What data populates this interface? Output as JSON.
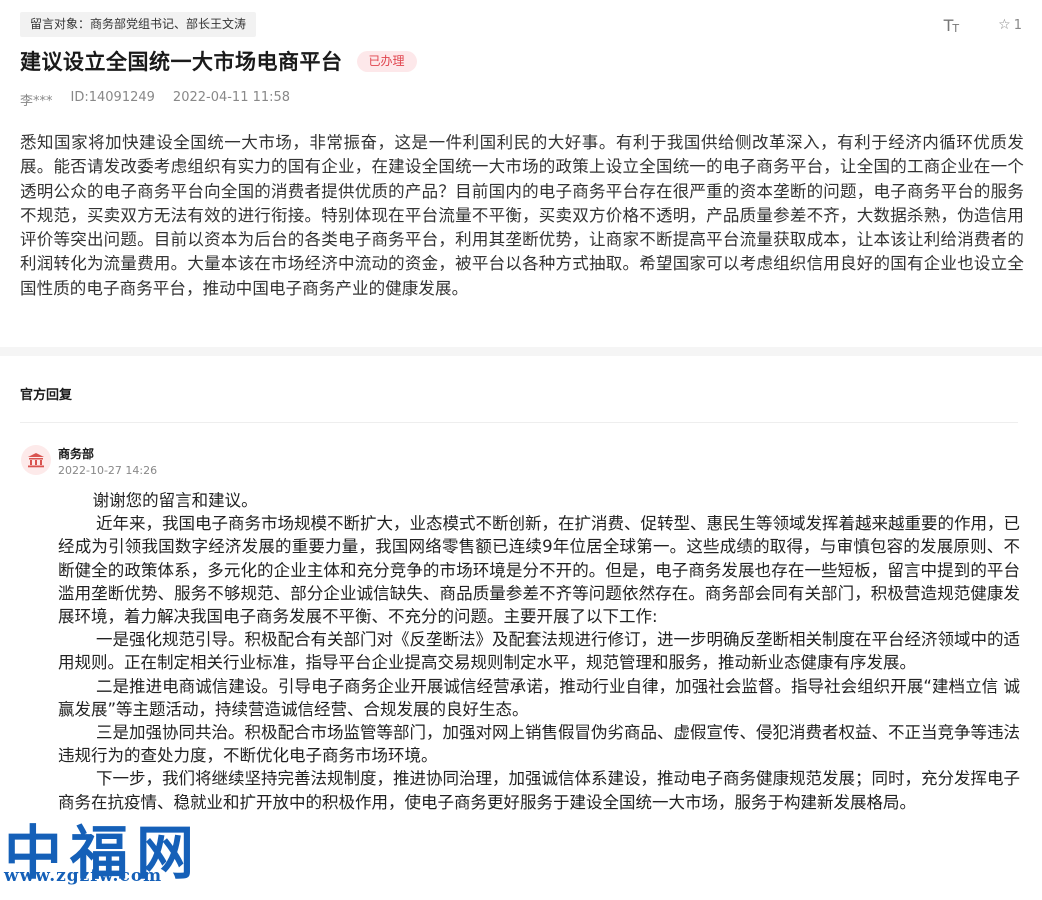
{
  "header": {
    "recipient": "留言对象：商务部党组书记、部长王文涛",
    "font_size_label": "TT",
    "star_icon": "star-outline-icon",
    "star_count": "1"
  },
  "post": {
    "title": "建议设立全国统一大市场电商平台",
    "status": "已办理",
    "author": "李***",
    "id": "ID:14091249",
    "datetime": "2022-04-11 11:58",
    "body": "悉知国家将加快建设全国统一大市场，非常振奋，这是一件利国利民的大好事。有利于我国供给侧改革深入，有利于经济内循环优质发展。能否请发改委考虑组织有实力的国有企业，在建设全国统一大市场的政策上设立全国统一的电子商务平台，让全国的工商企业在一个透明公众的电子商务平台向全国的消费者提供优质的产品？目前国内的电子商务平台存在很严重的资本垄断的问题，电子商务平台的服务不规范，买卖双方无法有效的进行衔接。特别体现在平台流量不平衡，买卖双方价格不透明，产品质量参差不齐，大数据杀熟，伪造信用评价等突出问题。目前以资本为后台的各类电子商务平台，利用其垄断优势，让商家不断提高平台流量获取成本，让本该让利给消费者的利润转化为流量费用。大量本该在市场经济中流动的资金，被平台以各种方式抽取。希望国家可以考虑组织信用良好的国有企业也设立全国性质的电子商务平台，推动中国电子商务产业的健康发展。"
  },
  "reply": {
    "heading": "官方回复",
    "department": "商务部",
    "department_icon": "government-building-icon",
    "datetime": "2022-10-27 14:26",
    "paragraphs": [
      "谢谢您的留言和建议。",
      "近年来，我国电子商务市场规模不断扩大，业态模式不断创新，在扩消费、促转型、惠民生等领域发挥着越来越重要的作用，已经成为引领我国数字经济发展的重要力量，我国网络零售额已连续9年位居全球第一。这些成绩的取得，与审慎包容的发展原则、不断健全的政策体系，多元化的企业主体和充分竞争的市场环境是分不开的。但是，电子商务发展也存在一些短板，留言中提到的平台滥用垄断优势、服务不够规范、部分企业诚信缺失、商品质量参差不齐等问题依然存在。商务部会同有关部门，积极营造规范健康发展环境，着力解决我国电子商务发展不平衡、不充分的问题。主要开展了以下工作:",
      "一是强化规范引导。积极配合有关部门对《反垄断法》及配套法规进行修订，进一步明确反垄断相关制度在平台经济领域中的适用规则。正在制定相关行业标准，指导平台企业提高交易规则制定水平，规范管理和服务，推动新业态健康有序发展。",
      "二是推进电商诚信建设。引导电子商务企业开展诚信经营承诺，推动行业自律，加强社会监督。指导社会组织开展“建档立信 诚赢发展”等主题活动，持续营造诚信经营、合规发展的良好生态。",
      "三是加强协同共治。积极配合市场监管等部门，加强对网上销售假冒伪劣商品、虚假宣传、侵犯消费者权益、不正当竞争等违法违规行为的查处力度，不断优化电子商务市场环境。",
      "下一步，我们将继续坚持完善法规制度，推进协同治理，加强诚信体系建设，推动电子商务健康规范发展；同时，充分发挥电子商务在抗疫情、稳就业和扩开放中的积极作用，使电子商务更好服务于建设全国统一大市场，服务于构建新发展格局。"
    ]
  },
  "watermark": {
    "chars": "中福网",
    "url": "www.zgzfw.com"
  },
  "colors": {
    "status_bg": "#fde8ea",
    "status_text": "#e0454f",
    "avatar_bg": "#fdeaea",
    "avatar_icon": "#d9534f",
    "watermark": "#1560b8"
  }
}
